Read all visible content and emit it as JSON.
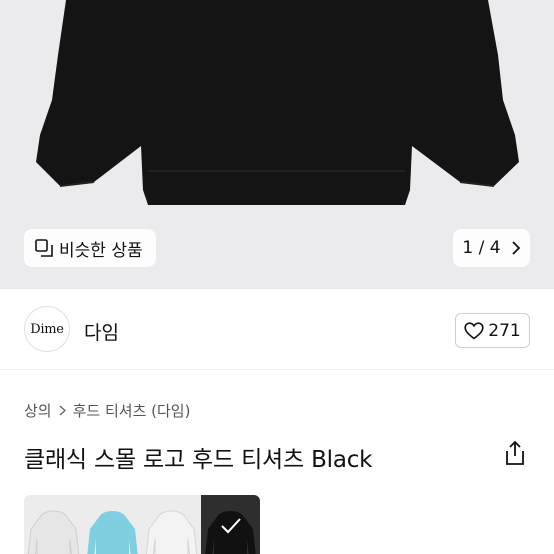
{
  "product": {
    "similar_label": "비슷한 상품",
    "pager": "1 / 4",
    "title": "클래식 스몰 로고 후드 티셔츠 Black"
  },
  "brand": {
    "logo_text": "Dime",
    "name": "다임",
    "likes": "271"
  },
  "breadcrumb": {
    "items": [
      "상의",
      "후드 티셔츠 (다임)"
    ]
  },
  "colors": {
    "thumbnails": [
      "#e6e6e6",
      "#7fcfe0",
      "#efefef",
      "#111111"
    ],
    "selected_index": 3
  },
  "icons": {
    "similar": "similar-items-icon",
    "pager_next": "chevron-right-icon",
    "like": "heart-icon",
    "breadcrumb_sep": "chevron-right-icon",
    "share": "share-icon",
    "selected": "check-icon"
  }
}
